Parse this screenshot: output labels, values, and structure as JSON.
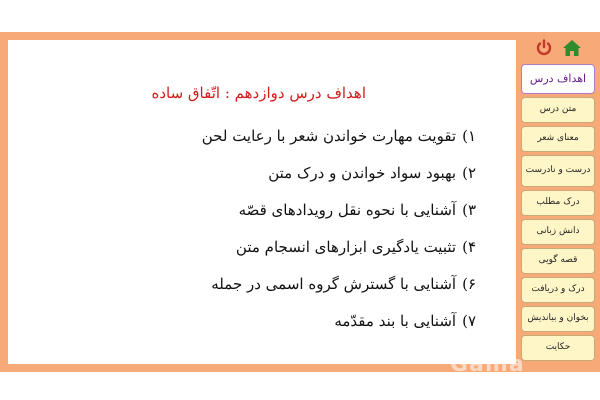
{
  "title": "اهداف درس دوازدهم : اتّفاق ساده",
  "objectives": [
    {
      "num": "۱)",
      "text": "تقویت مهارت خواندن شعر با رعایت لحن"
    },
    {
      "num": "۲)",
      "text": "بهبود سواد خواندن و درک متن"
    },
    {
      "num": "۳)",
      "text": "آشنایی با نحوه نقل رویدادهای قصّه"
    },
    {
      "num": "۴)",
      "text": "تثبیت یادگیری ابزارهای انسجام متن"
    },
    {
      "num": "۶)",
      "text": "آشنایی با گسترش گروه اسمی در جمله"
    },
    {
      "num": "۷)",
      "text": "آشنایی با بند مقدّمه"
    }
  ],
  "menu": [
    {
      "label": "اهداف درس",
      "active": true
    },
    {
      "label": "متن درس"
    },
    {
      "label": "معنای شعر"
    },
    {
      "label": "درست و نادرست"
    },
    {
      "label": "درک مطلب"
    },
    {
      "label": "دانش زبانی"
    },
    {
      "label": "قصه گویی"
    },
    {
      "label": "درک و دریافت"
    },
    {
      "label": "بخوان و بیاندیش"
    },
    {
      "label": "حکایت"
    }
  ],
  "watermark": "Gama",
  "colors": {
    "frame": "#f7a977",
    "title": "#d41a1a",
    "menu_bg": "#fff6c8",
    "active_text": "#6a1a8a",
    "home_icon": "#2e8b2e",
    "power_icon": "#c0392b"
  }
}
